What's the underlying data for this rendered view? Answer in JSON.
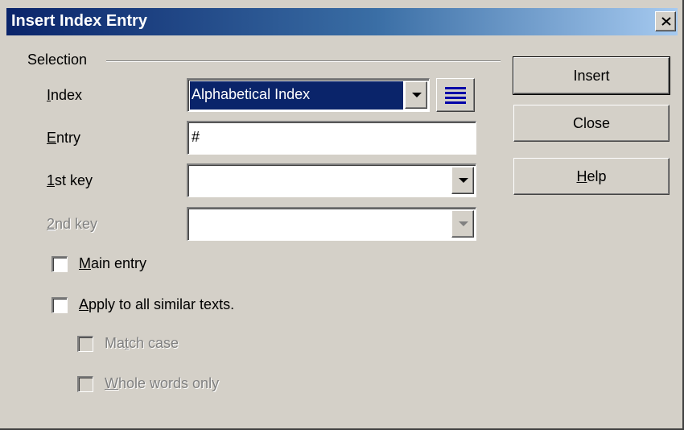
{
  "window": {
    "title": "Insert Index Entry",
    "close_label": "×"
  },
  "selection": {
    "group_title": "Selection",
    "index": {
      "label_access": "I",
      "label_rest": "ndex",
      "value": "Alphabetical Index"
    },
    "entry": {
      "label_access": "E",
      "label_rest": "ntry",
      "value": "#"
    },
    "key1": {
      "label_access": "1",
      "label_rest": "st key",
      "value": ""
    },
    "key2": {
      "label_access": "2",
      "label_rest": "nd key",
      "value": ""
    }
  },
  "options": {
    "main_entry": {
      "access": "M",
      "rest": "ain entry",
      "checked": false
    },
    "apply_all": {
      "access": "A",
      "rest": "pply to all similar texts.",
      "checked": false
    },
    "match_case": {
      "pre": "Ma",
      "access": "t",
      "rest": "ch case",
      "checked": false
    },
    "whole_words": {
      "access": "W",
      "rest": "hole words only",
      "checked": false
    }
  },
  "buttons": {
    "insert": "Insert",
    "close": "Close",
    "help_access": "H",
    "help_rest": "elp"
  }
}
